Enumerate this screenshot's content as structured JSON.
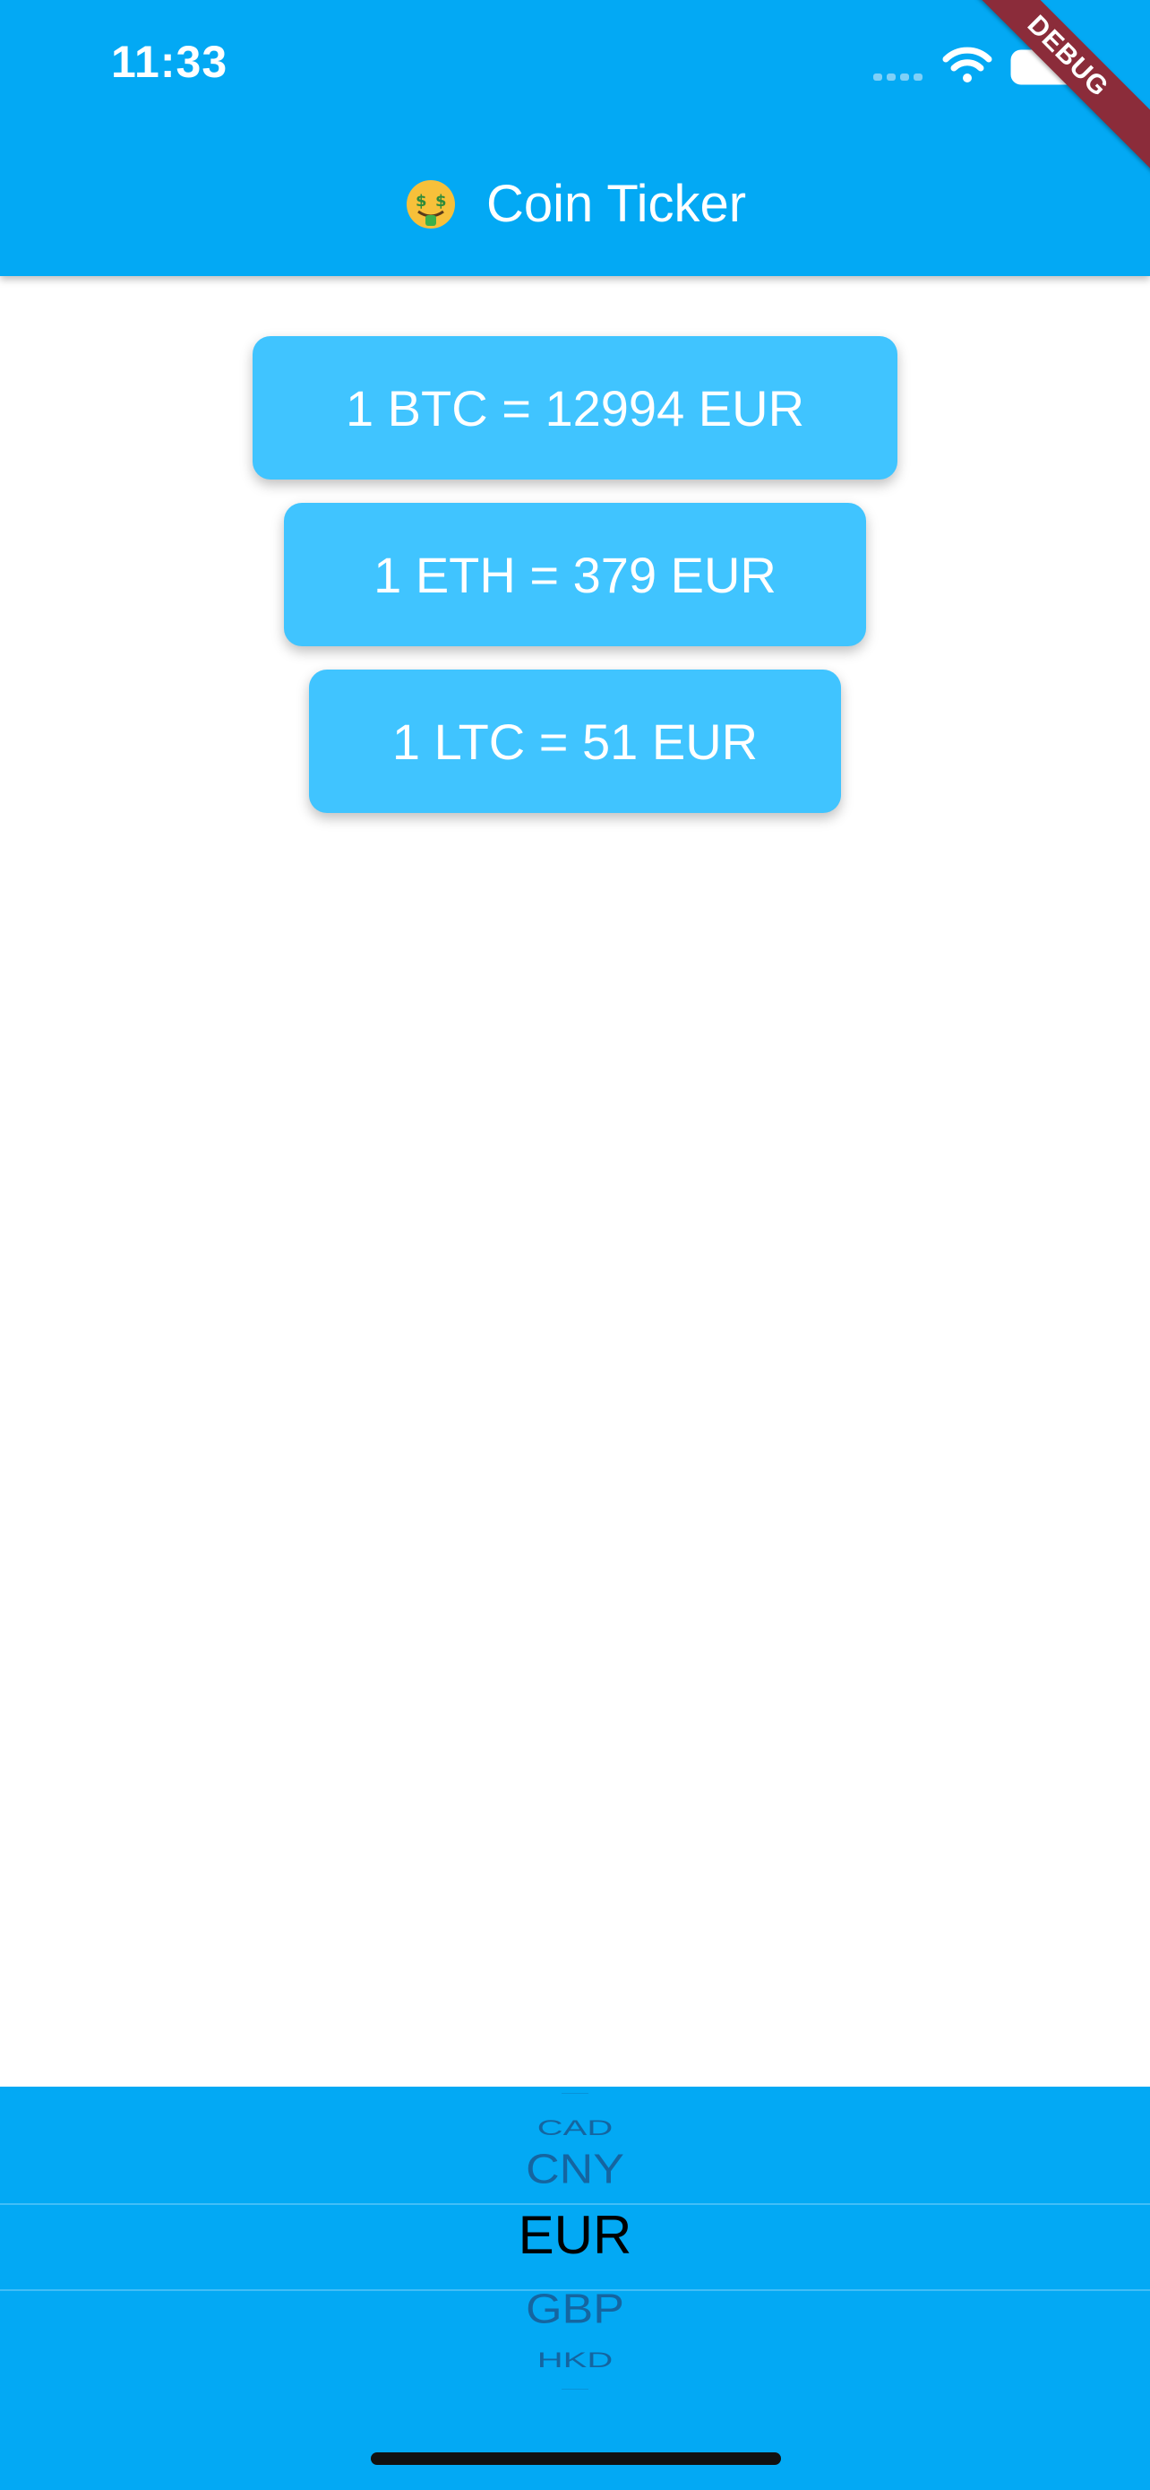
{
  "status_bar": {
    "time": "11:33",
    "icons": [
      "signal-icon",
      "wifi-icon",
      "battery-icon"
    ]
  },
  "app_bar": {
    "title": "Coin Ticker",
    "title_icon": "money-mouth-face-icon",
    "color": "#03A9F4"
  },
  "debug_banner": "DEBUG",
  "rates": [
    {
      "label": "1 BTC = 12994 EUR"
    },
    {
      "label": "1 ETH = 379 EUR"
    },
    {
      "label": "1 LTC = 51 EUR"
    }
  ],
  "card_color": "#40C4FF",
  "picker": {
    "items": [
      "CAD",
      "CNY",
      "EUR",
      "GBP",
      "HKD"
    ],
    "selected": "EUR"
  }
}
